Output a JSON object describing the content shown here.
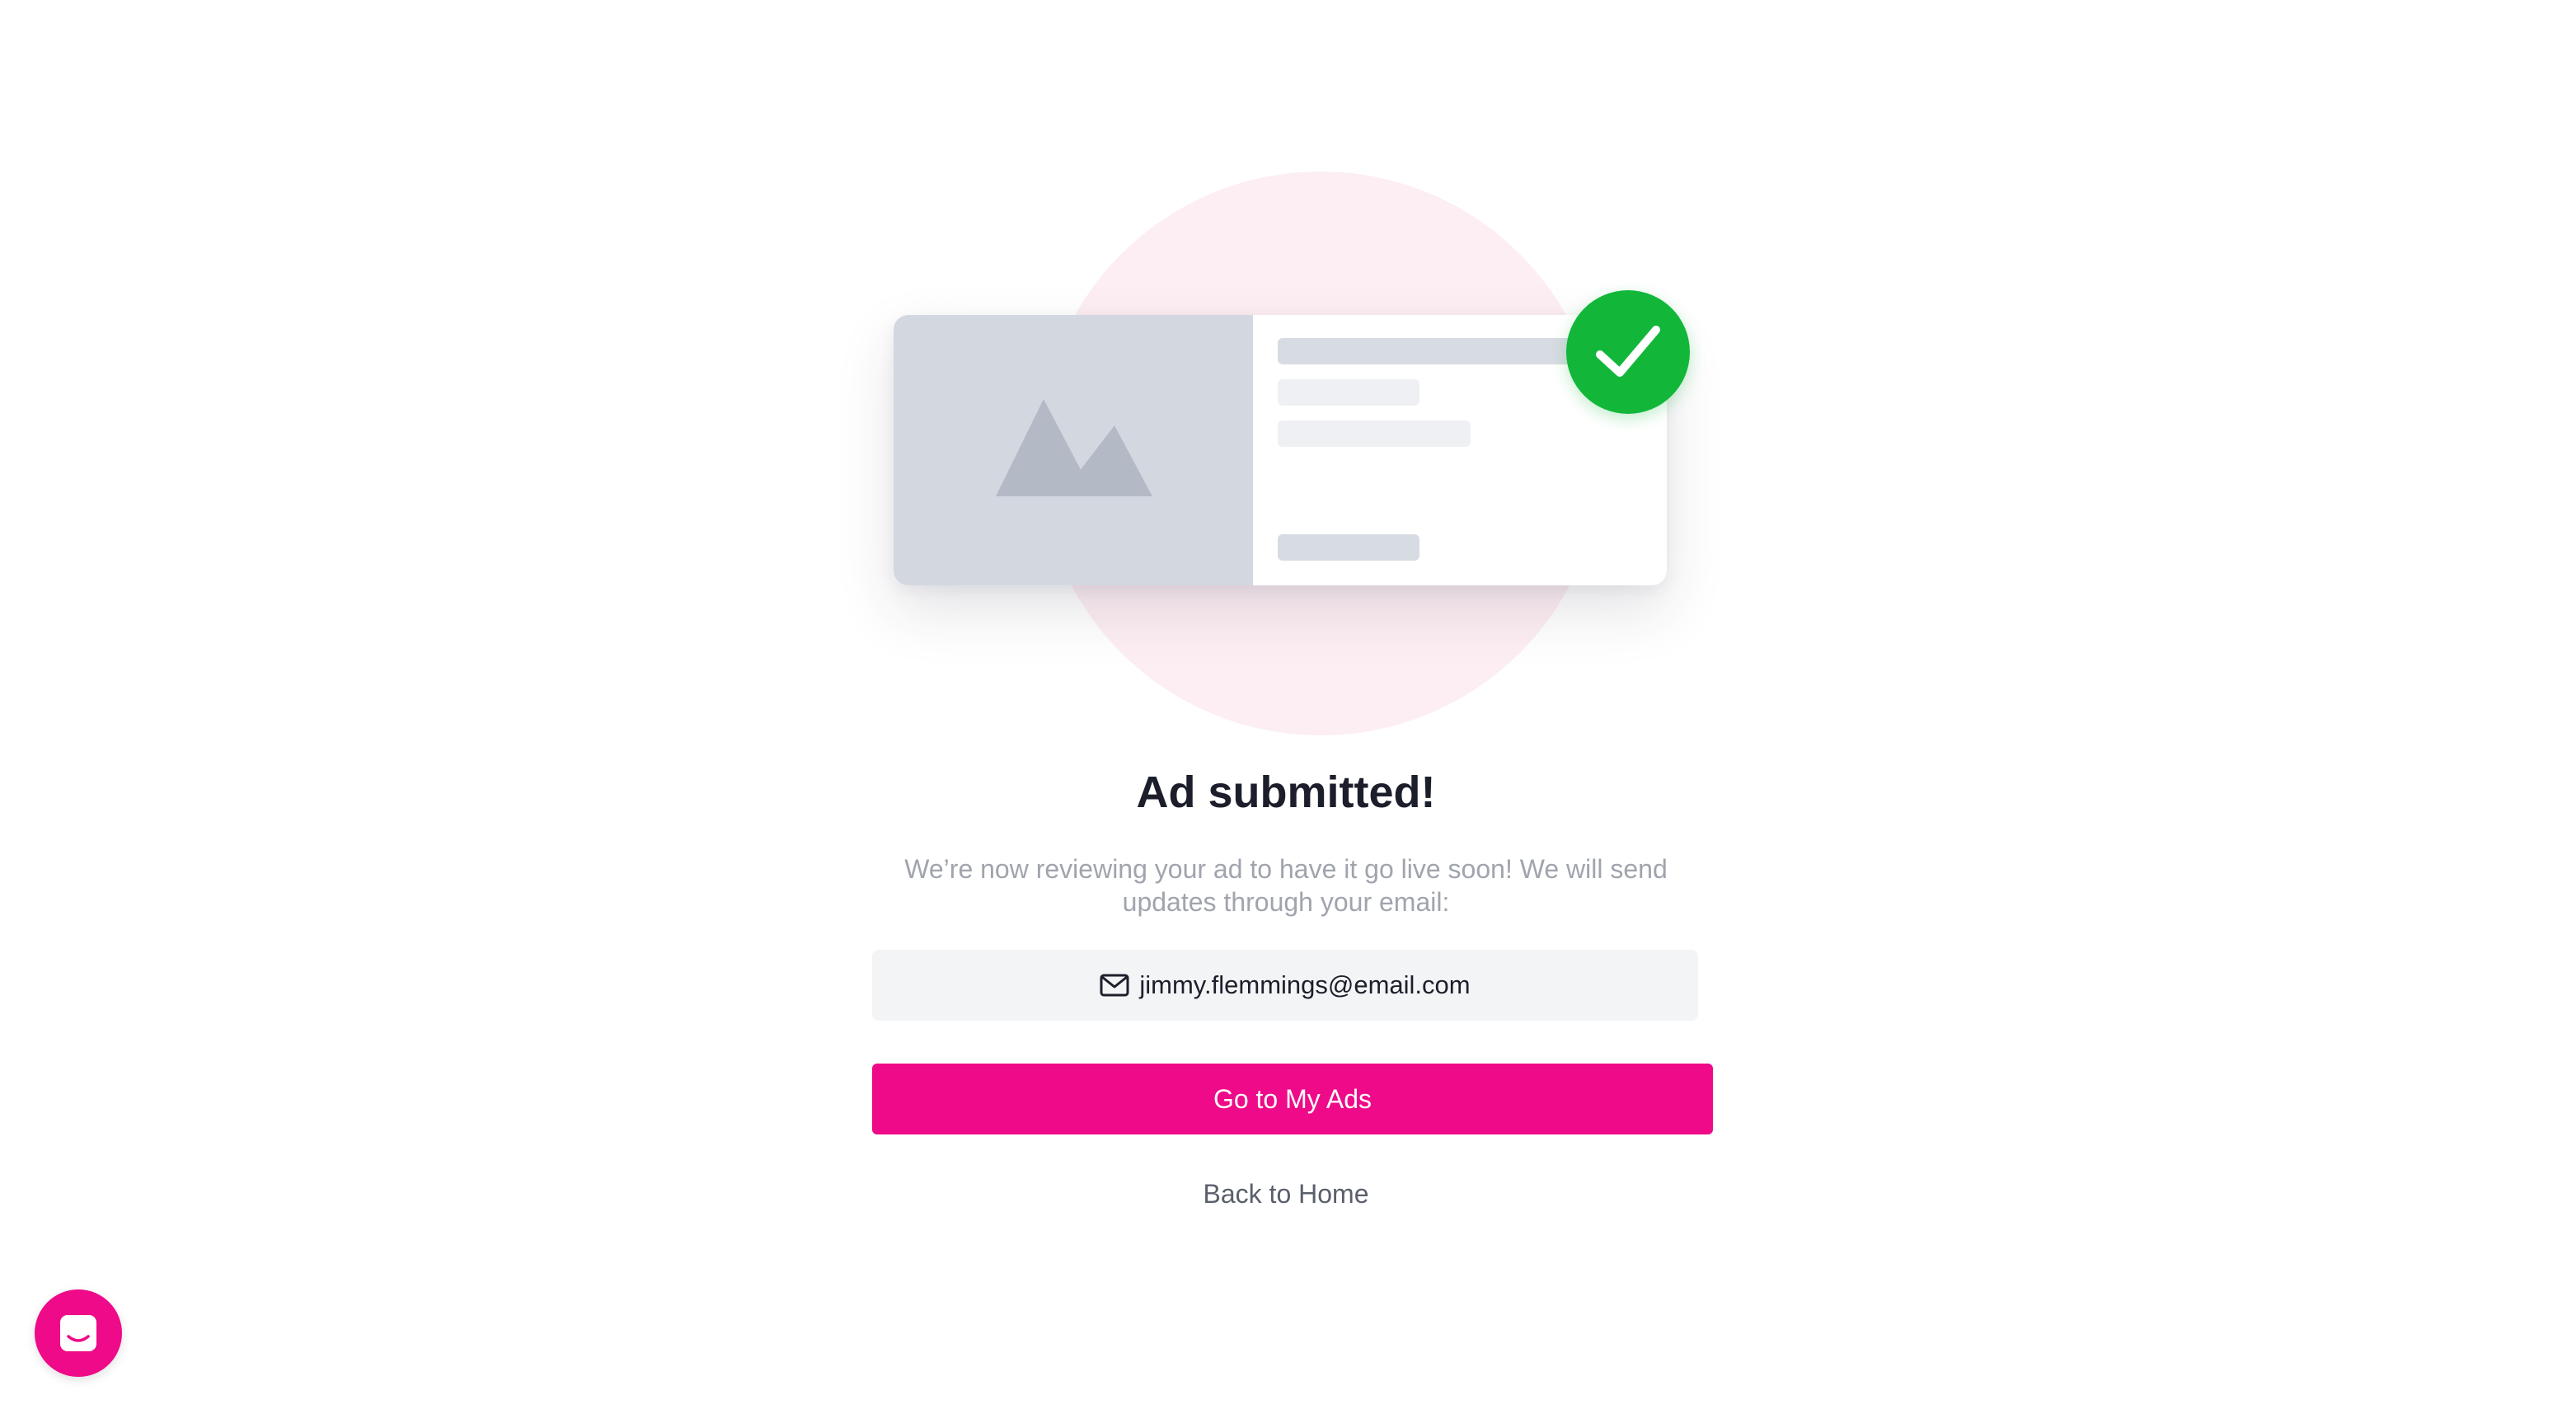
{
  "confirmation": {
    "title": "Ad submitted!",
    "message": "We’re now reviewing your ad to have it go live soon! We will send updates through your email:",
    "email": "jimmy.flemmings@email.com"
  },
  "actions": {
    "primary_label": "Go to My Ads",
    "secondary_label": "Back to Home"
  },
  "icons": {
    "illustration": "image-placeholder-icon",
    "badge": "checkmark-icon",
    "email": "mail-icon",
    "chat": "chat-icon"
  },
  "colors": {
    "accent": "#ee0a88",
    "success": "#12b73a",
    "title": "#1c1f2b",
    "muted": "#a0a4ad"
  }
}
